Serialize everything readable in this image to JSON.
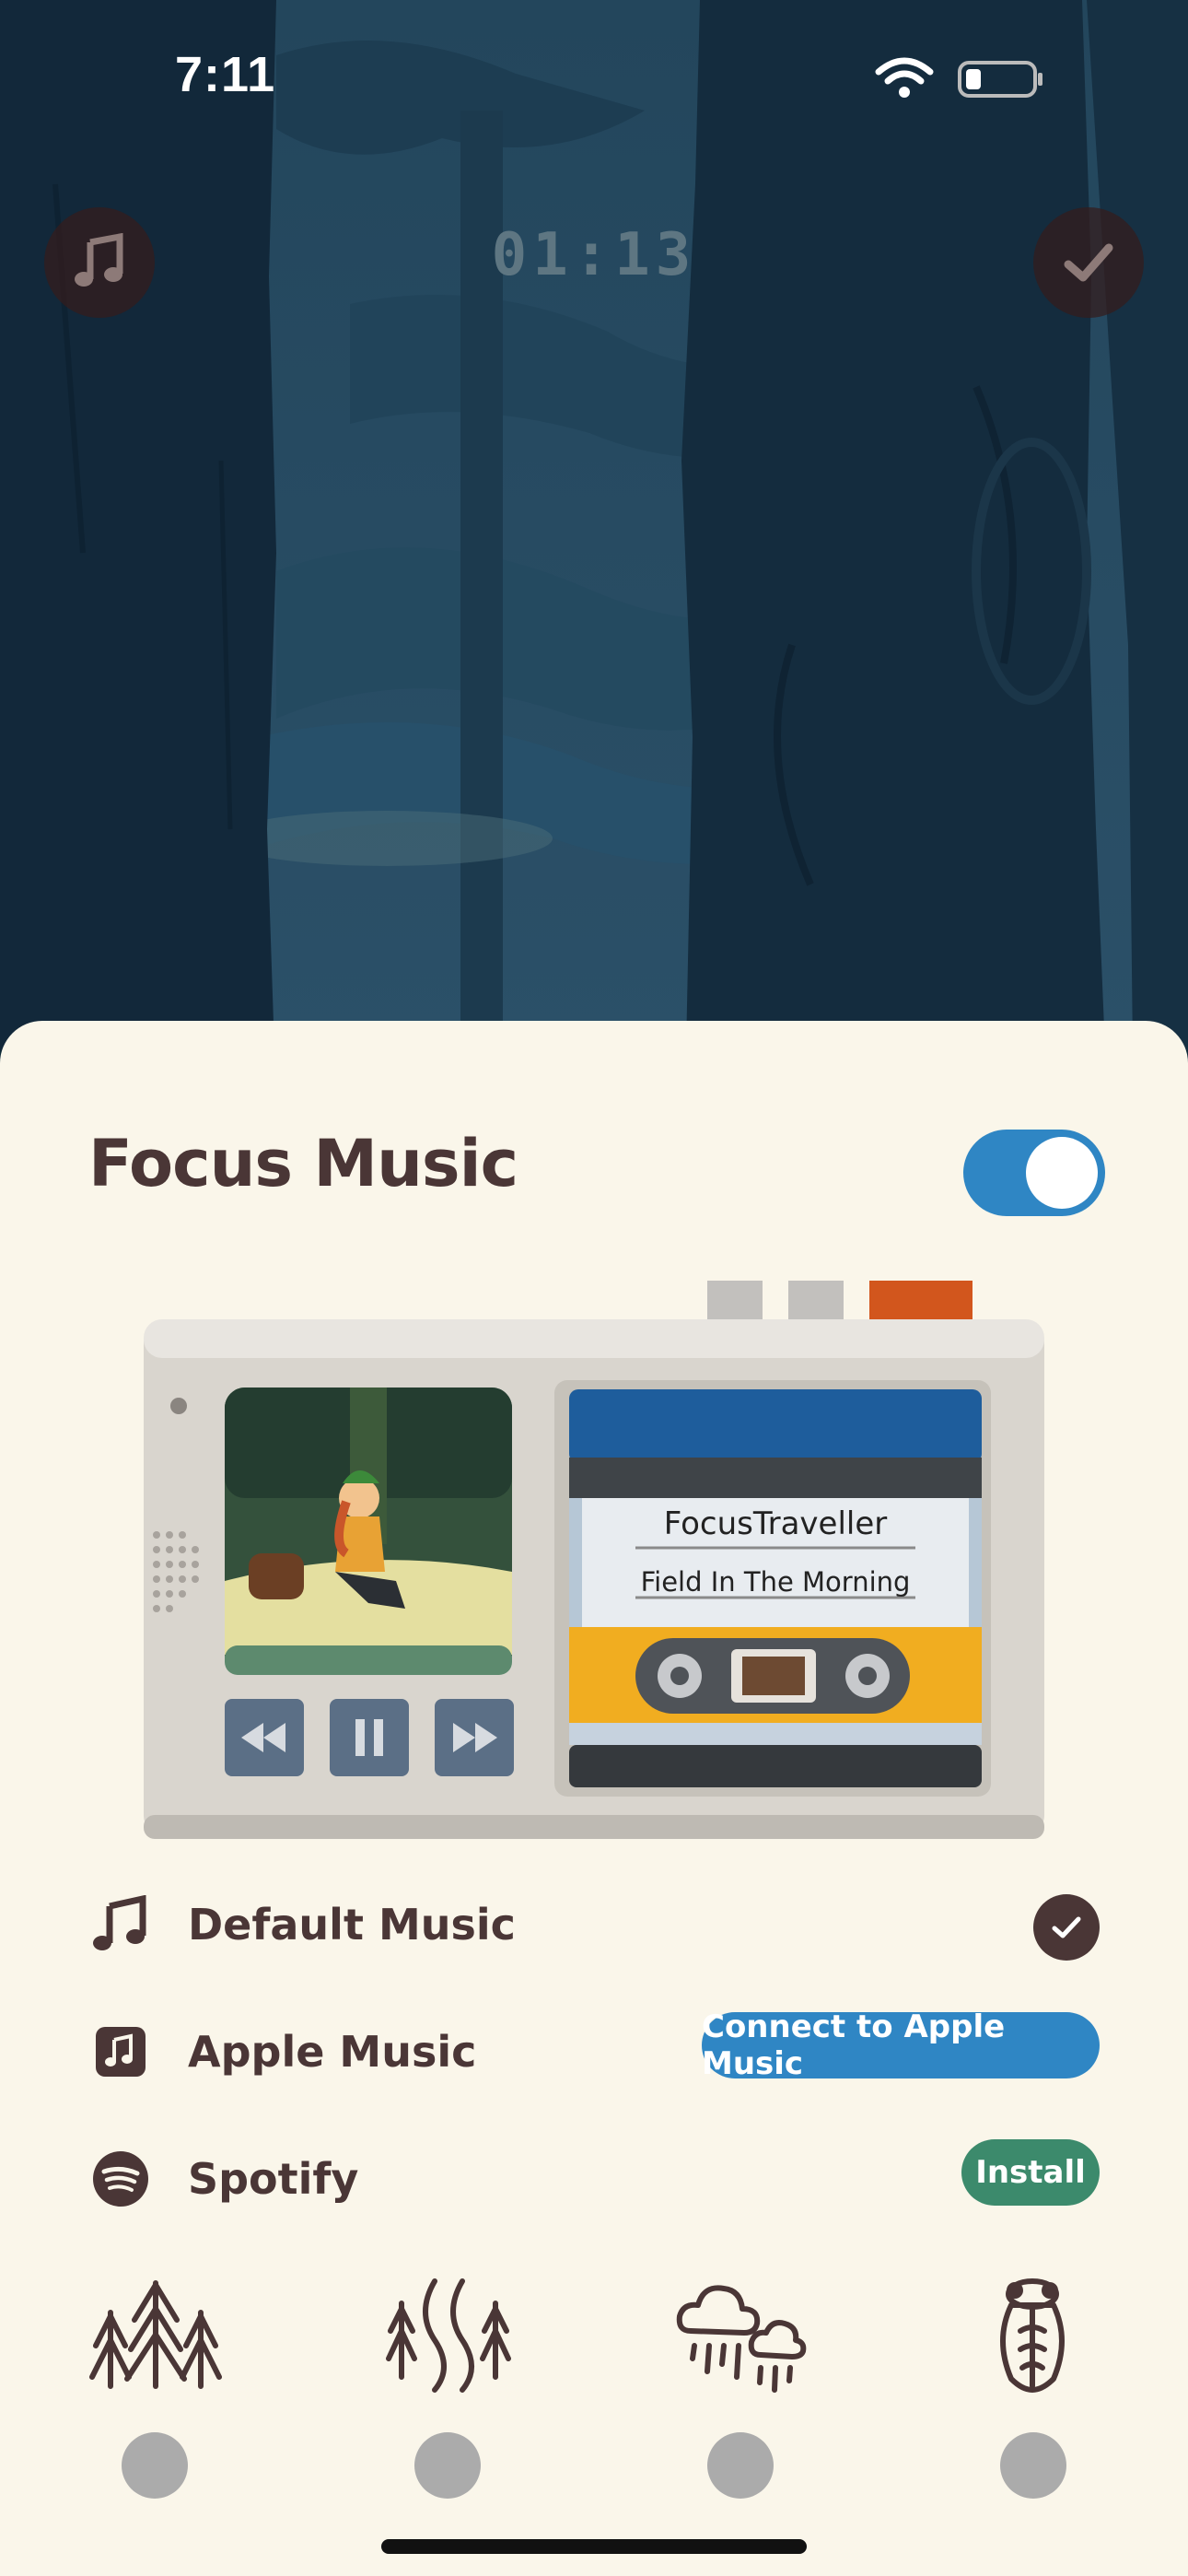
{
  "status_bar": {
    "time": "7:11"
  },
  "header": {
    "timer": "01:13"
  },
  "sheet": {
    "title": "Focus Music",
    "toggle_on": true
  },
  "player": {
    "artist": "FocusTraveller",
    "track": "Field In The Morning",
    "state": "playing"
  },
  "sources": [
    {
      "label": "Default Music",
      "icon": "music-note-icon",
      "selected": true
    },
    {
      "label": "Apple Music",
      "icon": "apple-music-icon",
      "action": "Connect to Apple Music"
    },
    {
      "label": "Spotify",
      "icon": "spotify-icon",
      "action": "Install"
    }
  ],
  "ambient_sounds": [
    "forest-icon",
    "stream-icon",
    "rain-icon",
    "cicada-icon"
  ],
  "colors": {
    "sheet_bg": "#faf6ea",
    "text": "#4a3636",
    "accent_blue": "#2f86c4",
    "accent_green": "#3c8a6c",
    "forest_bg": "#2a4a5e"
  }
}
